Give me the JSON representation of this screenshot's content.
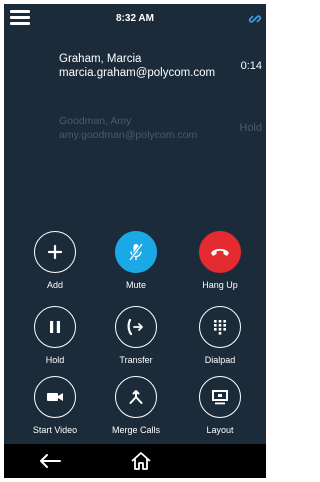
{
  "status_bar": {
    "time": "8:32 AM",
    "menu_icon": "hamburger-menu-icon",
    "link_icon": "link-icon"
  },
  "calls": [
    {
      "name": "Graham, Marcia",
      "email": "marcia.graham@polycom.com",
      "status": "0:14",
      "state": "active"
    },
    {
      "name": "Goodman, Amy",
      "email": "amy.goodman@polycom.com",
      "status": "Hold",
      "state": "held"
    }
  ],
  "controls": {
    "add": "Add",
    "mute": "Mute",
    "hang_up": "Hang Up",
    "hold": "Hold",
    "transfer": "Transfer",
    "dialpad": "Dialpad",
    "start_video": "Start Video",
    "merge_calls": "Merge Calls",
    "layout": "Layout"
  },
  "nav_bar": {
    "back_icon": "back-arrow-icon",
    "home_icon": "home-icon"
  },
  "colors": {
    "background": "#1b2b3a",
    "mute_accent": "#1aa8e6",
    "hang_up_accent": "#e42b2f",
    "held_text": "#4b5a68"
  }
}
